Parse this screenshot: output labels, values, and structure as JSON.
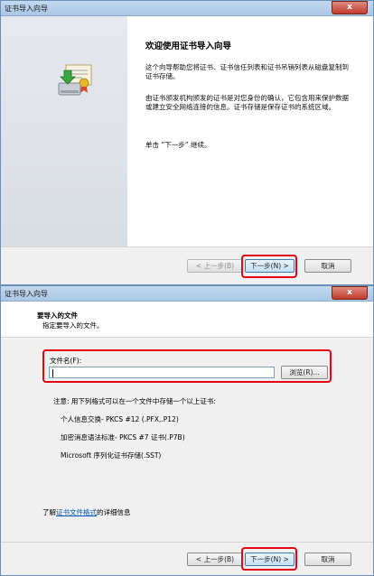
{
  "window1": {
    "title": "证书导入向导",
    "close_label": "x",
    "heading": "欢迎使用证书导入向导",
    "paragraph1": "这个向导帮助您将证书、证书信任列表和证书吊销列表从磁盘复制到证书存储。",
    "paragraph2": "由证书颁发机构颁发的证书是对您身份的确认，它包含用来保护数据或建立安全网络连接的信息。证书存储是保存证书的系统区域。",
    "paragraph3": "单击 “下一步” 继续。",
    "buttons": {
      "back": "< 上一步(B)",
      "next": "下一步(N) >",
      "cancel": "取消"
    }
  },
  "window2": {
    "title": "证书导入向导",
    "close_label": "x",
    "header_title": "要导入的文件",
    "header_subtitle": "指定要导入的文件。",
    "filename_label": "文件名(F):",
    "filename_value": "",
    "browse_button": "浏览(R)...",
    "note": "注意: 用下列格式可以在一个文件中存储一个以上证书:",
    "formats": [
      "个人信息交换- PKCS #12 (.PFX,.P12)",
      "加密消息语法标准- PKCS #7 证书(.P7B)",
      "Microsoft 序列化证书存储(.SST)"
    ],
    "learn_prefix": "了解",
    "learn_link": "证书文件格式",
    "learn_suffix": "的详细信息",
    "buttons": {
      "back": "< 上一步(B)",
      "next": "下一步(N) >",
      "cancel": "取消"
    }
  },
  "colors": {
    "highlight": "#e30613",
    "link": "#0055b3"
  }
}
